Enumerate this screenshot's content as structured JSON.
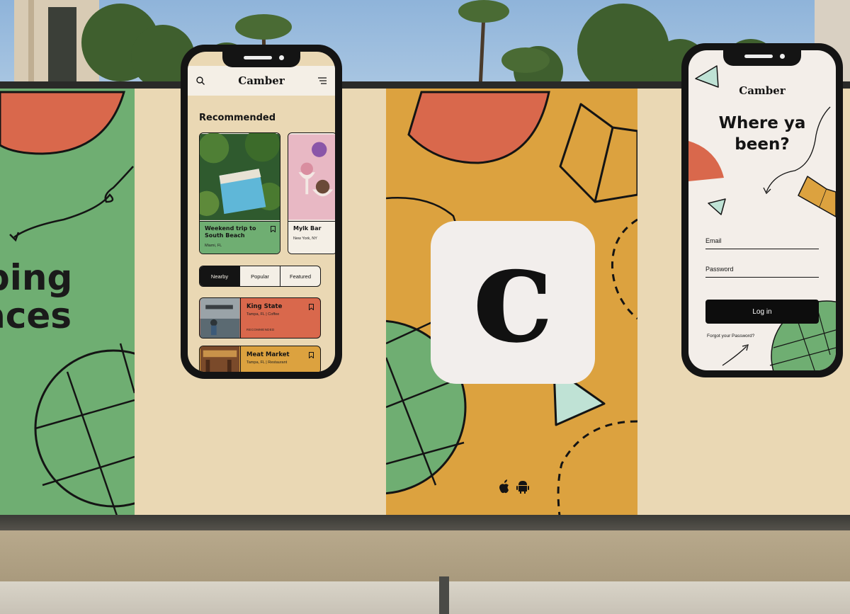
{
  "colors": {
    "green": "#6fae72",
    "cream": "#ead8b4",
    "mustard": "#dca23f",
    "coral": "#d9684c",
    "mint": "#bfe2d5",
    "ink": "#141414"
  },
  "panel1": {
    "line1": "ping",
    "line2": "aces"
  },
  "phone_browse": {
    "brand": "Camber",
    "search_icon": "search-icon",
    "menu_icon": "menu-icon",
    "section_title": "Recommended",
    "cards": [
      {
        "title": "Weekend trip to South Beach",
        "subtitle": "Miami, FL"
      },
      {
        "title": "Mylk Bar",
        "subtitle": "New York, NY"
      }
    ],
    "tabs": [
      "Nearby",
      "Popular",
      "Featured"
    ],
    "list": [
      {
        "title": "King State",
        "subtitle": "Tampa, FL | Coffee",
        "extra": "RECOMMENDED"
      },
      {
        "title": "Meat Market",
        "subtitle": "Tampa, FL | Restaurant"
      }
    ]
  },
  "app_icon": {
    "letter": "c",
    "platforms": [
      "apple-icon",
      "android-icon"
    ]
  },
  "phone_login": {
    "brand": "Camber",
    "headline_1": "Where ya",
    "headline_2": "been?",
    "email_label": "Email",
    "password_label": "Password",
    "login_label": "Log in",
    "forgot_label": "Forgot your Password?"
  }
}
